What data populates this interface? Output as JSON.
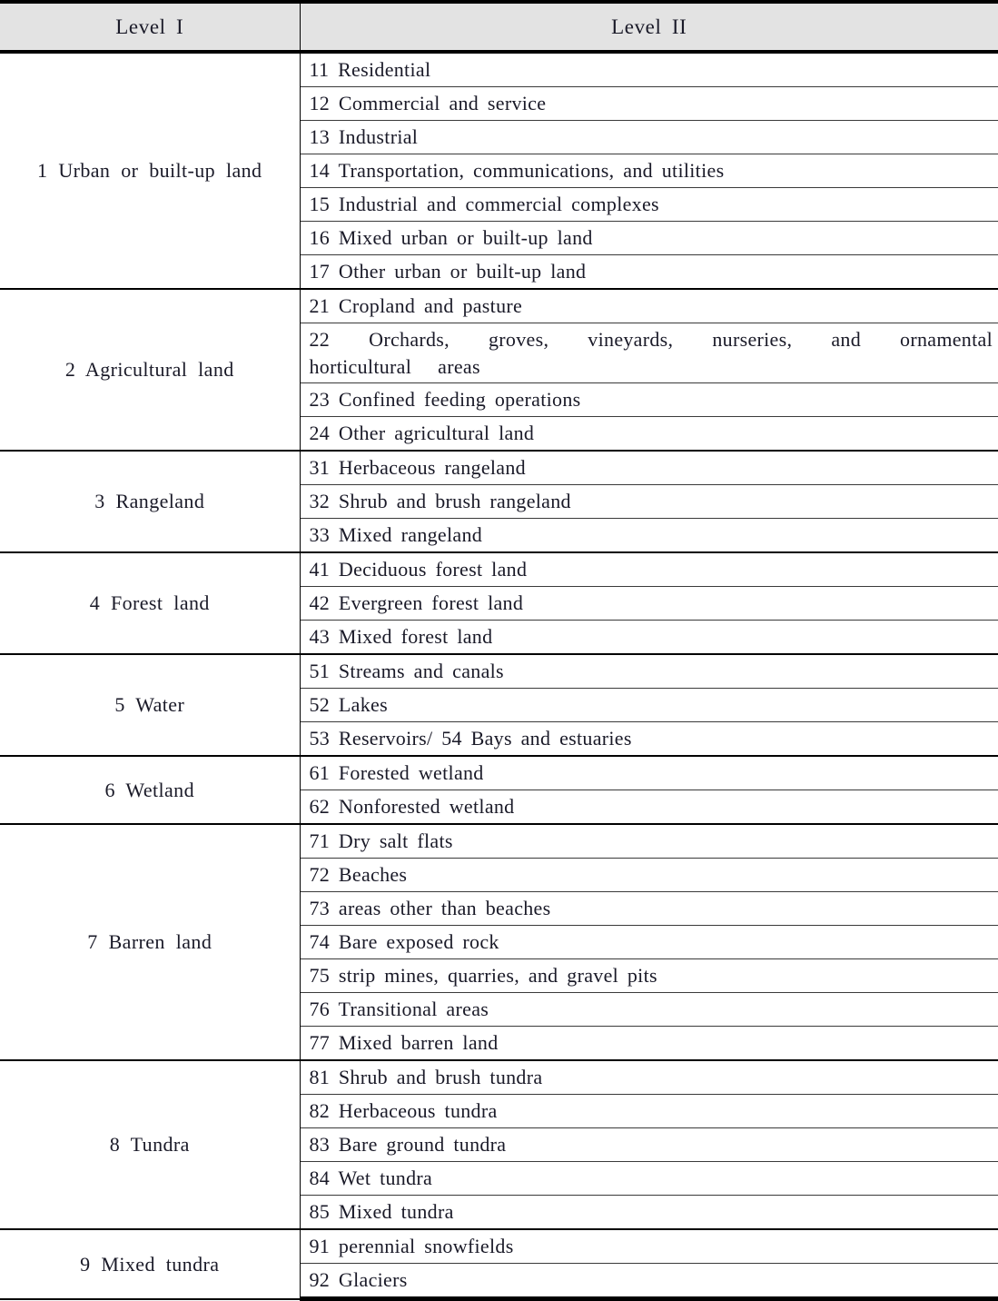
{
  "table": {
    "columns": [
      {
        "key": "level1",
        "label": "Level  I"
      },
      {
        "key": "level2",
        "label": "Level  II"
      }
    ],
    "header_background": "#e3e3e3",
    "border_color": "#000000",
    "groups": [
      {
        "level1": "1 Urban or built-up land",
        "level2": [
          "11 Residential",
          "12 Commercial and service",
          "13 Industrial",
          "14 Transportation, communications, and utilities",
          "15 Industrial and commercial complexes",
          "16 Mixed urban or built-up land",
          "17 Other urban or built-up land"
        ]
      },
      {
        "level1": "2 Agricultural land",
        "level2": [
          "21 Cropland and pasture",
          "22 Orchards, groves, vineyards, nurseries, and ornamental horticultural    areas",
          "23 Confined feeding operations",
          "24 Other agricultural land"
        ]
      },
      {
        "level1": "3 Rangeland",
        "level2": [
          "31 Herbaceous rangeland",
          "32 Shrub and brush rangeland",
          "33 Mixed rangeland"
        ]
      },
      {
        "level1": "4 Forest land",
        "level2": [
          "41 Deciduous forest land",
          "42 Evergreen forest land",
          "43 Mixed forest land"
        ]
      },
      {
        "level1": "5 Water",
        "level2": [
          "51 Streams and canals",
          "52 Lakes",
          "53 Reservoirs/ 54 Bays and estuaries"
        ]
      },
      {
        "level1": "6 Wetland",
        "level2": [
          "61 Forested wetland",
          "62 Nonforested wetland"
        ]
      },
      {
        "level1": "7 Barren land",
        "level2": [
          "71 Dry salt flats",
          "72 Beaches",
          "73 areas other than beaches",
          "74 Bare exposed rock",
          "75 strip mines, quarries, and gravel pits",
          "76 Transitional areas",
          "77 Mixed barren land"
        ]
      },
      {
        "level1": "8 Tundra",
        "level2": [
          "81 Shrub and brush tundra",
          "82 Herbaceous tundra",
          "83 Bare ground tundra",
          "84 Wet tundra",
          "85 Mixed tundra"
        ]
      },
      {
        "level1": "9 Mixed tundra",
        "level2": [
          "91 perennial snowfields",
          "92 Glaciers"
        ]
      }
    ],
    "wrapped_cells": {
      "22": {
        "line1": "22   Orchards,   groves,   vineyards,   nurseries,   and   ornamental",
        "line2": "horticultural     areas"
      }
    }
  }
}
